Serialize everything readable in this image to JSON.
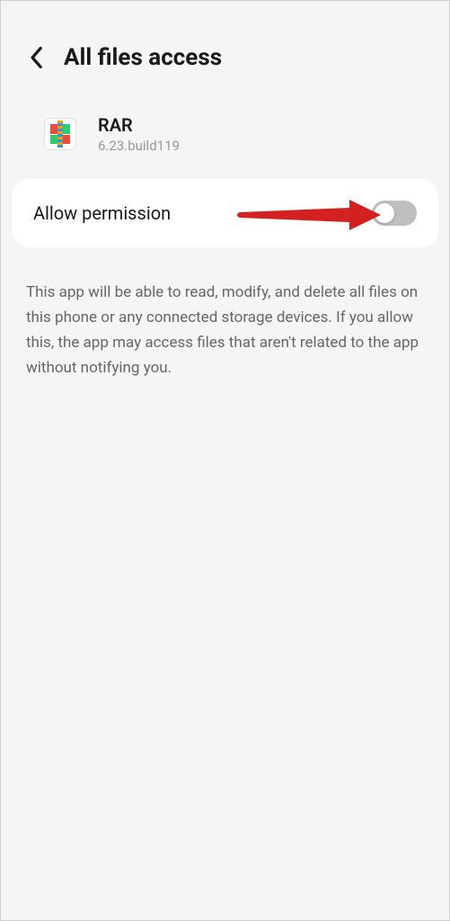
{
  "header": {
    "title": "All files access"
  },
  "app": {
    "name": "RAR",
    "version": "6.23.build119"
  },
  "permission": {
    "label": "Allow permission",
    "enabled": false
  },
  "description": "This app will be able to read, modify, and delete all files on this phone or any connected storage devices. If you allow this, the app may access files that aren't related to the app without notifying you."
}
